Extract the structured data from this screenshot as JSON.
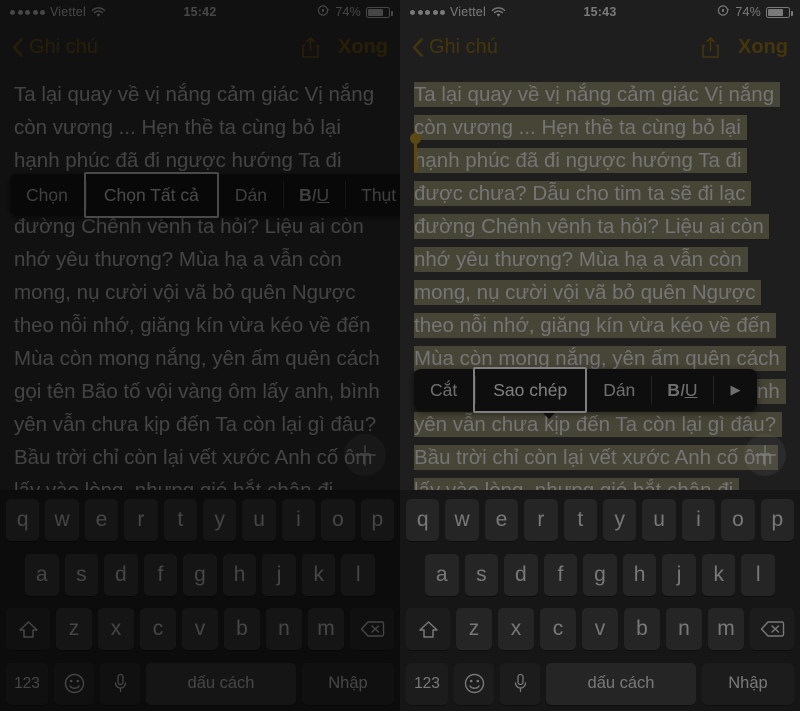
{
  "panels": [
    {
      "id": "left",
      "status": {
        "carrier": "Viettel",
        "signal_dots": 5,
        "wifi_icon": "wifi-icon",
        "time": "15:42",
        "rotation_lock_icon": "rotation-lock-icon",
        "battery_percent": "74%",
        "battery_level": 74
      },
      "nav": {
        "back_icon": "chevron-left-icon",
        "back_label": "Ghi chú",
        "share_icon": "share-icon",
        "done_label": "Xong",
        "accent_color": "#8a6a14"
      },
      "note": {
        "text": "Ta lại quay về vị nắng cảm giác Vị nắng còn vương ... Hẹn thề ta cùng bỏ lại hạnh phúc đã đi ngược hướng Ta đi được chưa? Dẫu cho tim ta sẽ đi lạc đường Chênh vênh ta hỏi? Liệu ai còn nhớ yêu thương? Mùa hạ a vẫn còn mong, nụ cười vội vã bỏ quên Ngược theo nỗi nhớ, giăng kín vừa kéo về đến Mùa còn mong nắng, yên ấm quên cách gọi tên Bão tố vội vàng ôm lấy anh, bình yên vẫn chưa kịp đến Ta còn lại gì đâu? Bầu trời chỉ còn lại vết xước Anh cố ôm lấy vào lòng, nhưng gió bắt chân đi ngược Anh sẽ vẽ những vệt nắng khi nỗi buồn chưa kịp lớn lên Giấc mơ sẽ vẫn ở lại? Khi đôi chân em nhẹ nhàng đến Anh đặt nỗi nhớ lên đôi tay MONG MỎI chờ",
        "has_selection": false,
        "add_button_icon": "plus-icon"
      },
      "popup": {
        "items": [
          {
            "label": "Chọn",
            "selected": false,
            "type": "text"
          },
          {
            "label": "Chọn Tất cả",
            "selected": true,
            "type": "text"
          },
          {
            "label": "Dán",
            "selected": false,
            "type": "text"
          },
          {
            "label": "BIU",
            "selected": false,
            "type": "biu"
          },
          {
            "label": "Thụt lề Bên phải",
            "selected": false,
            "type": "text"
          }
        ]
      }
    },
    {
      "id": "right",
      "status": {
        "carrier": "Viettel",
        "signal_dots": 5,
        "wifi_icon": "wifi-icon",
        "time": "15:43",
        "rotation_lock_icon": "rotation-lock-icon",
        "battery_percent": "74%",
        "battery_level": 74
      },
      "nav": {
        "back_icon": "chevron-left-icon",
        "back_label": "Ghi chú",
        "share_icon": "share-icon",
        "done_label": "Xong",
        "accent_color": "#8a6a14"
      },
      "note": {
        "text": "Ta lại quay về vị nắng cảm giác Vị nắng còn vương ... Hẹn thề ta cùng bỏ lại hạnh phúc đã đi ngược hướng Ta đi được chưa? Dẫu cho tim ta sẽ đi lạc đường Chênh vênh ta hỏi? Liệu ai còn nhớ yêu thương? Mùa hạ a vẫn còn mong, nụ cười vội vã bỏ quên Ngược theo nỗi nhớ, giăng kín vừa kéo về đến Mùa còn mong nắng, yên ấm quên cách gọi tên Bão tố vội vàng ôm lấy anh, bình yên vẫn chưa kịp đến Ta còn lại gì đâu? Bầu trời chỉ còn lại vết xước Anh cố ôm lấy vào lòng, nhưng gió bắt chân đi ngược Anh sẽ vẽ những vệt nắng khi nỗi buồn chưa kịp lớn lên Giấc mơ sẽ vẫn ở lại? Khi đôi chân em nhẹ nhàng đến Anh đặt nỗi nhớ lên đôi tay MONG MỎI chờ",
        "has_selection": true,
        "selection_color": "#8e8a6b",
        "selection_handle_color": "#b8912a",
        "add_button_icon": "plus-icon"
      },
      "popup": {
        "items": [
          {
            "label": "Cắt",
            "selected": false,
            "type": "text"
          },
          {
            "label": "Sao chép",
            "selected": true,
            "type": "text"
          },
          {
            "label": "Dán",
            "selected": false,
            "type": "text"
          },
          {
            "label": "BIU",
            "selected": false,
            "type": "biu"
          },
          {
            "label": "▶",
            "selected": false,
            "type": "arrow"
          }
        ]
      }
    }
  ],
  "keyboard": {
    "row1": [
      "q",
      "w",
      "e",
      "r",
      "t",
      "y",
      "u",
      "i",
      "o",
      "p"
    ],
    "row2": [
      "a",
      "s",
      "d",
      "f",
      "g",
      "h",
      "j",
      "k",
      "l"
    ],
    "row3_letters": [
      "z",
      "x",
      "c",
      "v",
      "b",
      "n",
      "m"
    ],
    "shift_icon": "shift-icon",
    "backspace_icon": "backspace-icon",
    "numeric_label": "123",
    "emoji_icon": "emoji-icon",
    "mic_icon": "microphone-icon",
    "space_label": "dấu cách",
    "return_label": "Nhập"
  }
}
